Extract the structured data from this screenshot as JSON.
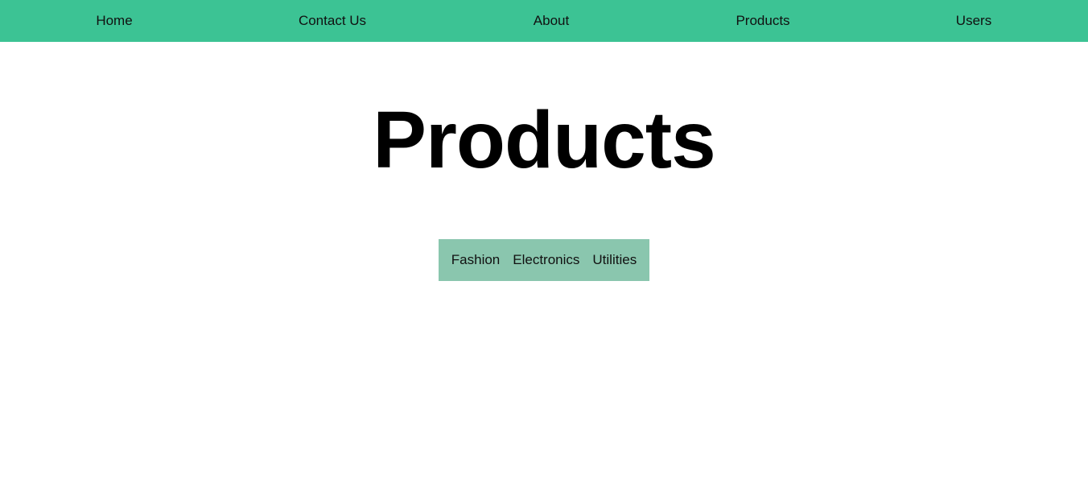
{
  "nav": {
    "items": [
      {
        "label": "Home"
      },
      {
        "label": "Contact Us"
      },
      {
        "label": "About"
      },
      {
        "label": "Products"
      },
      {
        "label": "Users"
      }
    ]
  },
  "main": {
    "title": "Products",
    "categories": [
      {
        "label": "Fashion"
      },
      {
        "label": "Electronics"
      },
      {
        "label": "Utilities"
      }
    ]
  },
  "colors": {
    "nav_background": "#3cc394",
    "category_bar_background": "#8ac6ae",
    "page_background": "#ffffff",
    "title_text": "#000000"
  }
}
